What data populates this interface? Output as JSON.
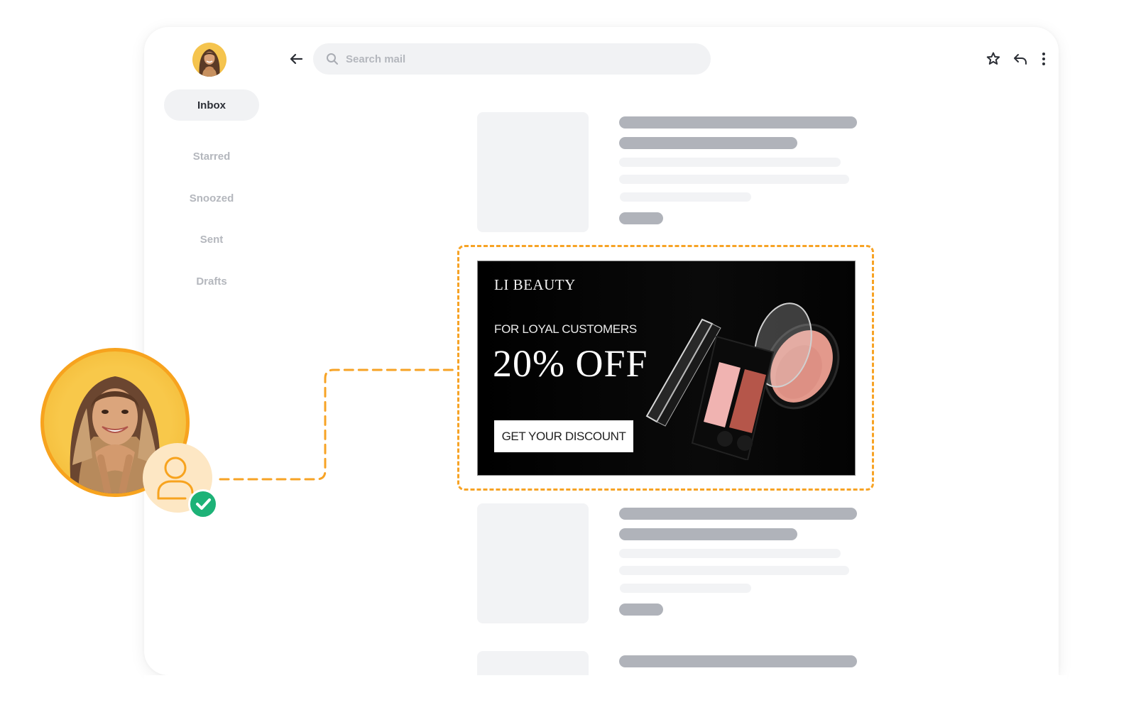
{
  "app": {
    "user_avatar_alt": "User avatar"
  },
  "sidebar": {
    "items": [
      {
        "label": "Inbox",
        "active": true
      },
      {
        "label": "Starred",
        "active": false
      },
      {
        "label": "Snoozed",
        "active": false
      },
      {
        "label": "Sent",
        "active": false
      },
      {
        "label": "Drafts",
        "active": false
      }
    ]
  },
  "toolbar": {
    "back_icon": "arrow-left-icon",
    "search_placeholder": "Search mail",
    "search_value": "",
    "search_icon": "search-icon",
    "actions": [
      "star-icon",
      "reply-icon",
      "more-vertical-icon"
    ]
  },
  "ad": {
    "brand": "LI BEAUTY",
    "subtitle": "FOR LOYAL CUSTOMERS",
    "headline": "20% OFF",
    "cta_label": "GET YOUR DISCOUNT",
    "product": "eyeshadow-and-blush-compacts"
  },
  "audience": {
    "avatar": "customer-photo",
    "badge_icon": "user-icon",
    "status_icon": "check-icon"
  },
  "colors": {
    "accent": "#f7a325",
    "success": "#1db277",
    "skeleton_dark": "#b0b3ba",
    "skeleton_light": "#f2f3f5",
    "nav_active_bg": "#f1f2f4"
  }
}
